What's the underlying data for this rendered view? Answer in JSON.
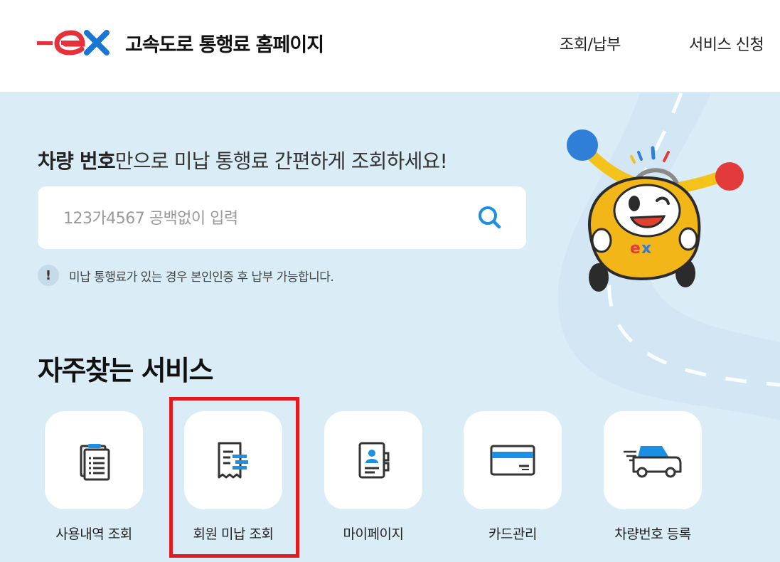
{
  "header": {
    "site_title": "고속도로 통행료 홈페이지",
    "logo_text": "ex",
    "nav": [
      "조회/납부",
      "서비스 신청"
    ]
  },
  "hero": {
    "headline_bold": "차량 번호",
    "headline_rest": "만으로 미납 통행료 간편하게 조회하세요!",
    "search_placeholder": "123가4567 공백없이 입력",
    "search_value": "",
    "notice_icon": "!",
    "notice": "미납 통행료가 있는 경우 본인인증 후 납부 가능합니다."
  },
  "services": {
    "title": "자주찾는 서비스",
    "items": [
      {
        "label": "사용내역 조회",
        "icon": "clipboard-list-icon"
      },
      {
        "label": "회원 미납 조회",
        "icon": "receipt-icon",
        "highlighted": true
      },
      {
        "label": "마이페이지",
        "icon": "profile-card-icon"
      },
      {
        "label": "카드관리",
        "icon": "credit-card-icon"
      },
      {
        "label": "차량번호 등록",
        "icon": "car-icon"
      }
    ]
  },
  "colors": {
    "brand_red": "#e8303a",
    "brand_blue": "#1976d2",
    "icon_blue": "#1a8fe3",
    "background": "#daedf7",
    "highlight_border": "#e21b23"
  },
  "mascot": {
    "badge_text": "ex"
  }
}
